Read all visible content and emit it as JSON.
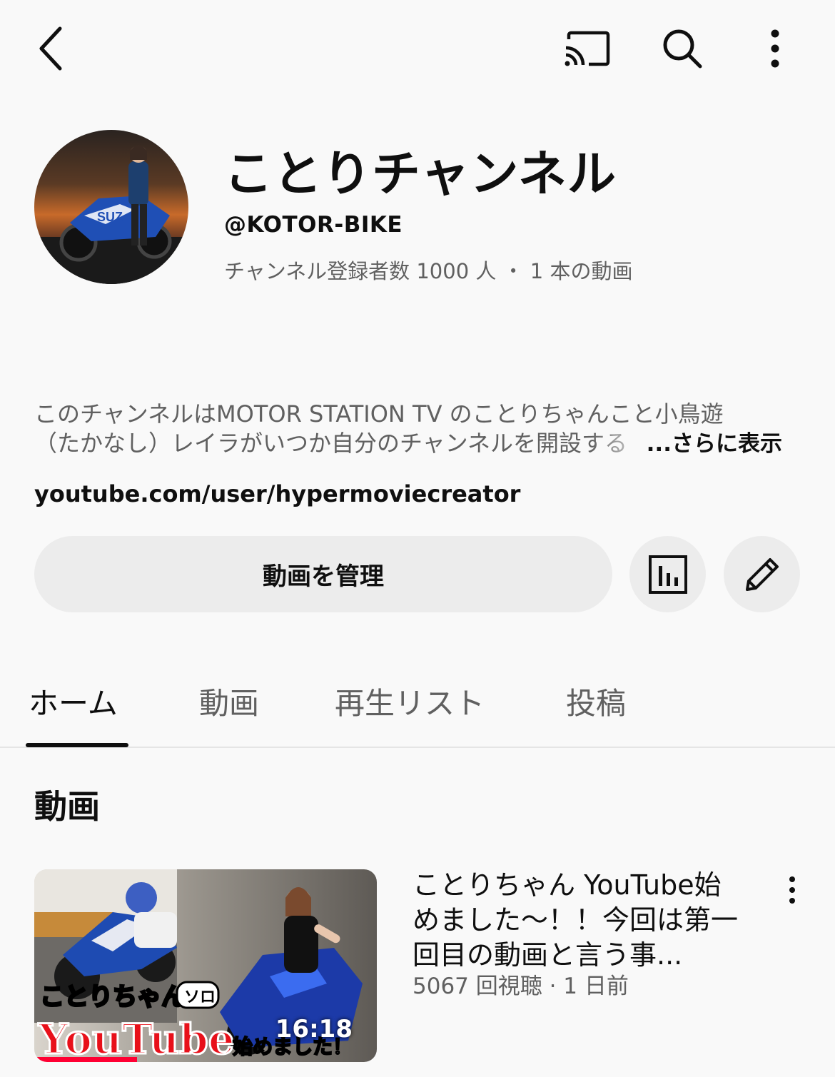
{
  "topbar": {
    "back_icon": "chevron-left-icon",
    "cast_icon": "cast-icon",
    "search_icon": "search-icon",
    "more_icon": "more-vertical-icon"
  },
  "channel": {
    "name": "ことりチャンネル",
    "handle": "@KOTOR-BIKE",
    "stats": "チャンネル登録者数 1000 人 ・ 1 本の動画",
    "description_line1": "このチャンネルはMOTOR STATION TV のことりちゃんこと小鳥遊",
    "description_line2": "（たかなし）レイラがいつか自分のチャンネルを開設する",
    "show_more": "...さらに表示",
    "link": "youtube.com/user/hypermoviecreator"
  },
  "actions": {
    "manage_label": "動画を管理",
    "analytics_icon": "analytics-chart-icon",
    "edit_icon": "pencil-edit-icon"
  },
  "tabs": [
    {
      "label": "ホーム",
      "active": true
    },
    {
      "label": "動画",
      "active": false
    },
    {
      "label": "再生リスト",
      "active": false
    },
    {
      "label": "投稿",
      "active": false
    }
  ],
  "section": {
    "title": "動画"
  },
  "video": {
    "title": "ことりちゃん YouTube始めました〜！！今回は第一回目の動画と言う事...",
    "meta": "5067 回視聴 · 1 日前",
    "duration": "16:18",
    "thumb_text_top": "ことりちゃん",
    "thumb_badge": "ソロ",
    "thumb_text_bottom": "YouTube",
    "thumb_text_tail": "始めました！",
    "watched_fraction": 0.3
  },
  "colors": {
    "background": "#f9f9f9",
    "button_bg": "#ececec",
    "secondary_text": "#606060",
    "accent_red": "#ff0033"
  }
}
